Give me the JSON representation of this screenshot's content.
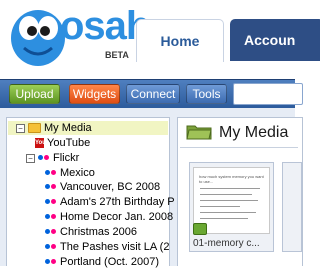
{
  "app": {
    "logo_text": "osah",
    "logo_badge": "BETA"
  },
  "tabs": [
    {
      "label": "Home",
      "active": true
    },
    {
      "label": "Accoun",
      "active": false
    }
  ],
  "toolbar": {
    "upload_label": "Upload",
    "widgets_label": "Widgets",
    "connect_label": "Connect",
    "tools_label": "Tools",
    "search_value": ""
  },
  "tree": {
    "root_label": "My Media",
    "youtube_label": "YouTube",
    "flickr_label": "Flickr",
    "flickr_sets": [
      "Mexico",
      "Vancouver, BC 2008",
      "Adam's 27th Birthday P",
      "Home Decor Jan. 2008",
      "Christmas 2006",
      "The Pashes visit LA (2",
      "Portland (Oct. 2007)"
    ]
  },
  "main": {
    "title": "My Media",
    "items": [
      {
        "label": "01-memory c...",
        "doc_text": "how much system memory you want to use..."
      }
    ]
  },
  "colors": {
    "brand_blue": "#2d8fe0",
    "toolbar_blue": "#3c6bb1",
    "upload_green": "#6aa832",
    "widgets_orange": "#ef6a2c",
    "selected_row": "#f1f5c3"
  }
}
